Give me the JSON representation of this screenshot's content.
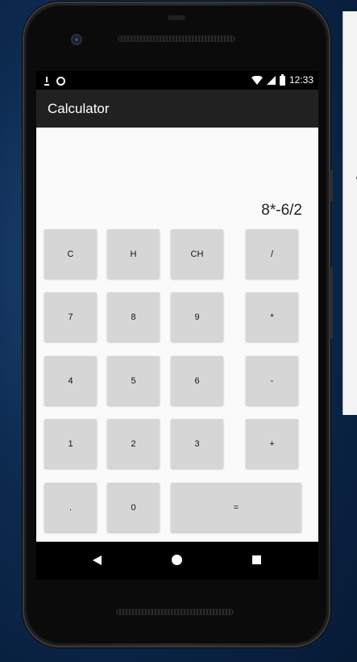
{
  "status_bar": {
    "time": "12:33",
    "left_icons": [
      "download-icon",
      "record-icon"
    ],
    "right_icons": [
      "wifi-icon",
      "cell-signal-icon",
      "battery-icon"
    ]
  },
  "app": {
    "title": "Calculator"
  },
  "display": {
    "expression": "8*-6/2"
  },
  "keys": {
    "clear": "C",
    "history": "H",
    "clear_history": "CH",
    "divide": "/",
    "seven": "7",
    "eight": "8",
    "nine": "9",
    "multiply": "*",
    "four": "4",
    "five": "5",
    "six": "6",
    "subtract": "-",
    "one": "1",
    "two": "2",
    "three": "3",
    "add": "+",
    "decimal": ".",
    "zero": "0",
    "equals": "="
  },
  "nav_bar": {
    "buttons": [
      "back-icon",
      "home-icon",
      "recents-icon"
    ]
  },
  "colors": {
    "app_bar": "#212121",
    "content_bg": "#fafafa",
    "key_bg": "#d6d6d6"
  }
}
